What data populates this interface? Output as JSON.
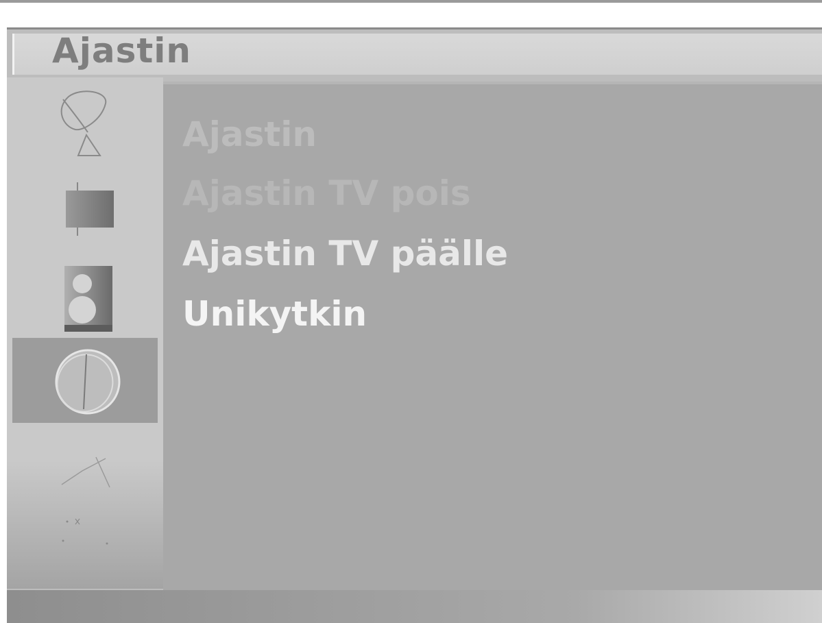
{
  "header": {
    "title": "Ajastin"
  },
  "sidebar": {
    "items": [
      {
        "icon": "satellite-dish-icon",
        "selected": false
      },
      {
        "icon": "picture-icon",
        "selected": false
      },
      {
        "icon": "sound-icon",
        "selected": false
      },
      {
        "icon": "clock-timer-icon",
        "selected": true
      },
      {
        "icon": "settings-icon",
        "selected": false
      },
      {
        "icon": "extra-icon",
        "selected": false
      }
    ]
  },
  "menu": {
    "items": [
      {
        "label": "Ajastin"
      },
      {
        "label": "Ajastin TV pois"
      },
      {
        "label": "Ajastin TV päälle"
      },
      {
        "label": "Unikytkin"
      }
    ]
  },
  "colors": {
    "panel": "#a8a8a8",
    "sidebar": "#c9c9c9",
    "selected_item": "#9c9c9c",
    "highlight_text": "#f4f4f4"
  }
}
